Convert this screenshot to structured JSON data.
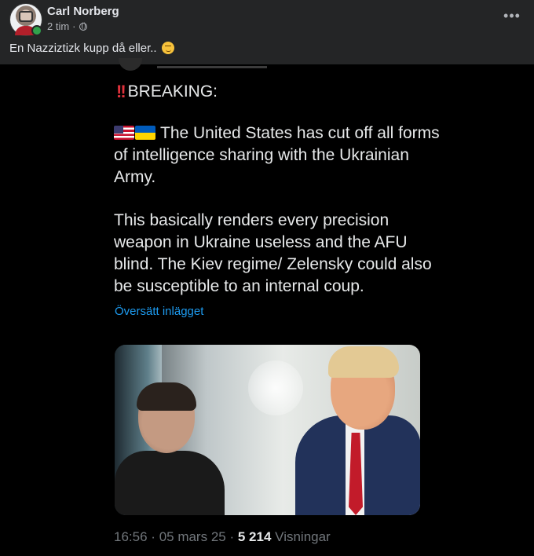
{
  "post": {
    "author": "Carl Norberg",
    "time": "2 tim",
    "separator": "·",
    "caption": "En Nazziztizk kupp då eller..",
    "caption_emoji": "smirk-emoji",
    "more_icon": "ellipsis-icon"
  },
  "tweet": {
    "breaking": "BREAKING:",
    "para1": "The United States has cut off all forms of intelligence sharing with the Ukrainian Army.",
    "para2": "This basically renders every precision weapon in Ukraine useless and the AFU blind. The Kiev regime/ Zelensky could also be susceptible to an internal coup.",
    "translate": "Översätt inlägget",
    "footer": {
      "time": "16:56",
      "date": "05 mars 25",
      "views_count": "5 214",
      "views_label": "Visningar"
    },
    "accent_color": "#1d9bf0"
  },
  "colors": {
    "header_bg": "#242526",
    "tweet_bg": "#000000",
    "online": "#31a24c"
  }
}
